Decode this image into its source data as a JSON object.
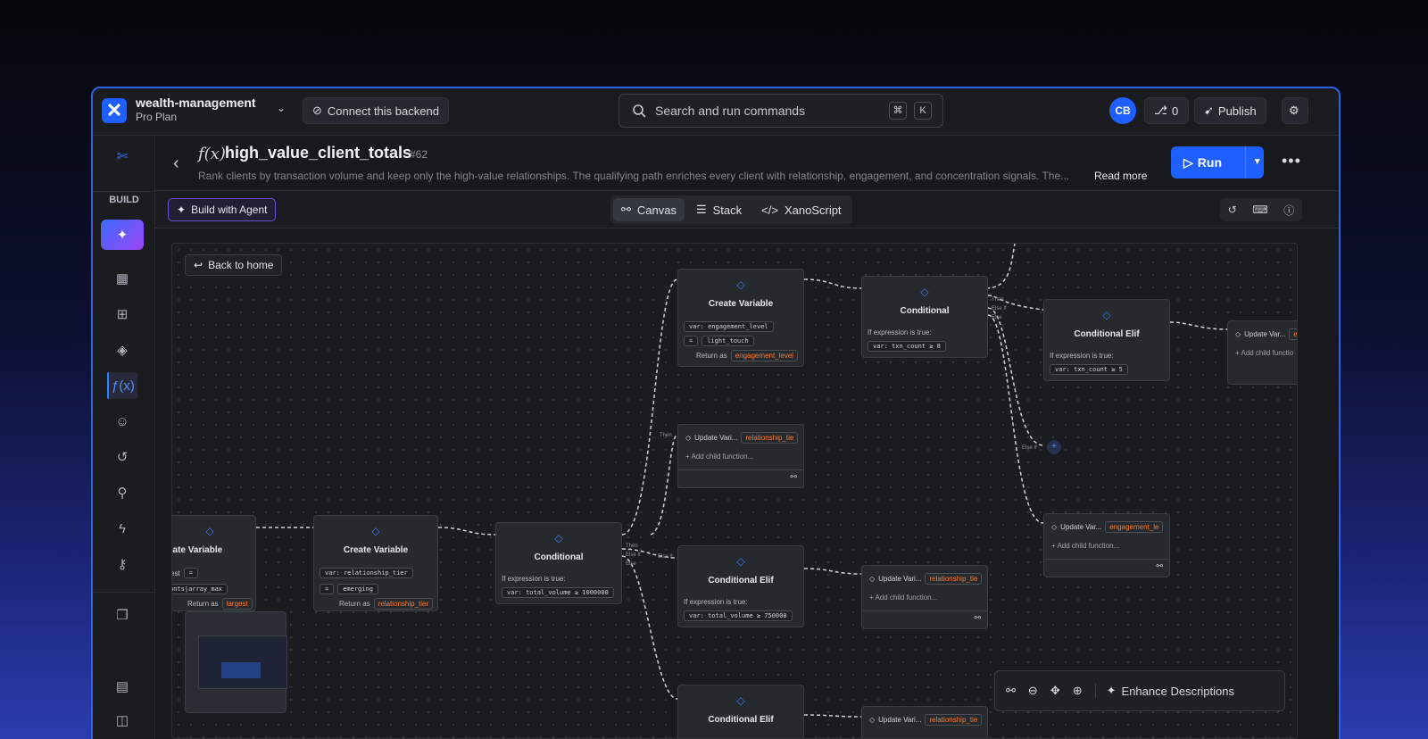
{
  "workspace": {
    "name": "wealth-management",
    "plan": "Pro Plan"
  },
  "topbar": {
    "connect_label": "Connect this backend",
    "search_placeholder": "Search and run commands",
    "kbd_cmd": "⌘",
    "kbd_k": "K",
    "avatar": "CB",
    "commits": "0",
    "publish_label": "Publish"
  },
  "sidebar": {
    "section_label": "BUILD"
  },
  "header": {
    "fx": "f(x)",
    "title": "high_value_client_totals",
    "id": "#62",
    "description": "Rank clients by transaction volume and keep only the high-value relationships. The qualifying path enriches every client with relationship, engagement, and concentration signals. The...",
    "read_more": "Read more",
    "run_label": "Run"
  },
  "toolbar": {
    "agent_label": "Build with Agent",
    "tabs": [
      "Canvas",
      "Stack",
      "XanoScript"
    ]
  },
  "canvas": {
    "back_label": "Back to home",
    "enhance_label": "Enhance Descriptions",
    "nodes": {
      "cv_largest": {
        "title": "eate Variable",
        "var": "rgest",
        "op": "=",
        "value": "unts|array_max",
        "return_prefix": "Return as",
        "return": "largest"
      },
      "cv_tier": {
        "title": "Create Variable",
        "var_prefix": "var:",
        "var": "relationship_tier",
        "op": "=",
        "value": "emerging",
        "return_prefix": "Return as",
        "return": "relationship_tier"
      },
      "cond_volume": {
        "title": "Conditional",
        "expr_label": "If expression is true:",
        "expr": "var: total_volume ≥ 1000000"
      },
      "cv_engagement": {
        "title": "Create Variable",
        "var_prefix": "var:",
        "var": "engagement_level",
        "op": "=",
        "value": "light_touch",
        "return_prefix": "Return as",
        "return": "engagement_level"
      },
      "cond_txn": {
        "title": "Conditional",
        "expr_label": "If expression is true:",
        "expr": "var: txn_count ≥ 8"
      },
      "elif_txn": {
        "title": "Conditional Elif",
        "expr_label": "If expression is true:",
        "expr": "var: txn_count ≥ 5"
      },
      "elif_volume": {
        "title": "Conditional Elif",
        "expr_label": "If expression is true:",
        "expr": "var: total_volume ≥ 750000"
      },
      "elif_bottom": {
        "title": "Conditional Elif"
      }
    },
    "updates": {
      "u1": {
        "label": "Update Vari...",
        "var": "relationship_tie",
        "add": "Add child function..."
      },
      "u2": {
        "label": "Update Var...",
        "var": "engagement_le",
        "add": "Add child function..."
      },
      "u3": {
        "label": "Update Vari...",
        "var": "relationship_tie",
        "add": "Add child function..."
      },
      "u4": {
        "label": "Update Var...",
        "var": "e",
        "add": "Add child functio"
      },
      "u5": {
        "label": "Update Vari...",
        "var": "relationship_tie"
      }
    },
    "branch_tags": {
      "then": "Then",
      "elseif": "Else If",
      "else": "Else"
    }
  }
}
